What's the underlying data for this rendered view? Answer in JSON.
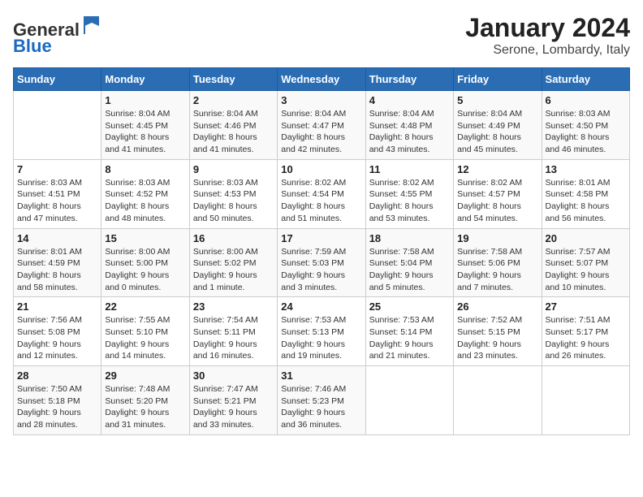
{
  "header": {
    "logo_general": "General",
    "logo_blue": "Blue",
    "title": "January 2024",
    "subtitle": "Serone, Lombardy, Italy"
  },
  "weekdays": [
    "Sunday",
    "Monday",
    "Tuesday",
    "Wednesday",
    "Thursday",
    "Friday",
    "Saturday"
  ],
  "weeks": [
    [
      {
        "day": "",
        "info": ""
      },
      {
        "day": "1",
        "info": "Sunrise: 8:04 AM\nSunset: 4:45 PM\nDaylight: 8 hours\nand 41 minutes."
      },
      {
        "day": "2",
        "info": "Sunrise: 8:04 AM\nSunset: 4:46 PM\nDaylight: 8 hours\nand 41 minutes."
      },
      {
        "day": "3",
        "info": "Sunrise: 8:04 AM\nSunset: 4:47 PM\nDaylight: 8 hours\nand 42 minutes."
      },
      {
        "day": "4",
        "info": "Sunrise: 8:04 AM\nSunset: 4:48 PM\nDaylight: 8 hours\nand 43 minutes."
      },
      {
        "day": "5",
        "info": "Sunrise: 8:04 AM\nSunset: 4:49 PM\nDaylight: 8 hours\nand 45 minutes."
      },
      {
        "day": "6",
        "info": "Sunrise: 8:03 AM\nSunset: 4:50 PM\nDaylight: 8 hours\nand 46 minutes."
      }
    ],
    [
      {
        "day": "7",
        "info": "Sunrise: 8:03 AM\nSunset: 4:51 PM\nDaylight: 8 hours\nand 47 minutes."
      },
      {
        "day": "8",
        "info": "Sunrise: 8:03 AM\nSunset: 4:52 PM\nDaylight: 8 hours\nand 48 minutes."
      },
      {
        "day": "9",
        "info": "Sunrise: 8:03 AM\nSunset: 4:53 PM\nDaylight: 8 hours\nand 50 minutes."
      },
      {
        "day": "10",
        "info": "Sunrise: 8:02 AM\nSunset: 4:54 PM\nDaylight: 8 hours\nand 51 minutes."
      },
      {
        "day": "11",
        "info": "Sunrise: 8:02 AM\nSunset: 4:55 PM\nDaylight: 8 hours\nand 53 minutes."
      },
      {
        "day": "12",
        "info": "Sunrise: 8:02 AM\nSunset: 4:57 PM\nDaylight: 8 hours\nand 54 minutes."
      },
      {
        "day": "13",
        "info": "Sunrise: 8:01 AM\nSunset: 4:58 PM\nDaylight: 8 hours\nand 56 minutes."
      }
    ],
    [
      {
        "day": "14",
        "info": "Sunrise: 8:01 AM\nSunset: 4:59 PM\nDaylight: 8 hours\nand 58 minutes."
      },
      {
        "day": "15",
        "info": "Sunrise: 8:00 AM\nSunset: 5:00 PM\nDaylight: 9 hours\nand 0 minutes."
      },
      {
        "day": "16",
        "info": "Sunrise: 8:00 AM\nSunset: 5:02 PM\nDaylight: 9 hours\nand 1 minute."
      },
      {
        "day": "17",
        "info": "Sunrise: 7:59 AM\nSunset: 5:03 PM\nDaylight: 9 hours\nand 3 minutes."
      },
      {
        "day": "18",
        "info": "Sunrise: 7:58 AM\nSunset: 5:04 PM\nDaylight: 9 hours\nand 5 minutes."
      },
      {
        "day": "19",
        "info": "Sunrise: 7:58 AM\nSunset: 5:06 PM\nDaylight: 9 hours\nand 7 minutes."
      },
      {
        "day": "20",
        "info": "Sunrise: 7:57 AM\nSunset: 5:07 PM\nDaylight: 9 hours\nand 10 minutes."
      }
    ],
    [
      {
        "day": "21",
        "info": "Sunrise: 7:56 AM\nSunset: 5:08 PM\nDaylight: 9 hours\nand 12 minutes."
      },
      {
        "day": "22",
        "info": "Sunrise: 7:55 AM\nSunset: 5:10 PM\nDaylight: 9 hours\nand 14 minutes."
      },
      {
        "day": "23",
        "info": "Sunrise: 7:54 AM\nSunset: 5:11 PM\nDaylight: 9 hours\nand 16 minutes."
      },
      {
        "day": "24",
        "info": "Sunrise: 7:53 AM\nSunset: 5:13 PM\nDaylight: 9 hours\nand 19 minutes."
      },
      {
        "day": "25",
        "info": "Sunrise: 7:53 AM\nSunset: 5:14 PM\nDaylight: 9 hours\nand 21 minutes."
      },
      {
        "day": "26",
        "info": "Sunrise: 7:52 AM\nSunset: 5:15 PM\nDaylight: 9 hours\nand 23 minutes."
      },
      {
        "day": "27",
        "info": "Sunrise: 7:51 AM\nSunset: 5:17 PM\nDaylight: 9 hours\nand 26 minutes."
      }
    ],
    [
      {
        "day": "28",
        "info": "Sunrise: 7:50 AM\nSunset: 5:18 PM\nDaylight: 9 hours\nand 28 minutes."
      },
      {
        "day": "29",
        "info": "Sunrise: 7:48 AM\nSunset: 5:20 PM\nDaylight: 9 hours\nand 31 minutes."
      },
      {
        "day": "30",
        "info": "Sunrise: 7:47 AM\nSunset: 5:21 PM\nDaylight: 9 hours\nand 33 minutes."
      },
      {
        "day": "31",
        "info": "Sunrise: 7:46 AM\nSunset: 5:23 PM\nDaylight: 9 hours\nand 36 minutes."
      },
      {
        "day": "",
        "info": ""
      },
      {
        "day": "",
        "info": ""
      },
      {
        "day": "",
        "info": ""
      }
    ]
  ]
}
